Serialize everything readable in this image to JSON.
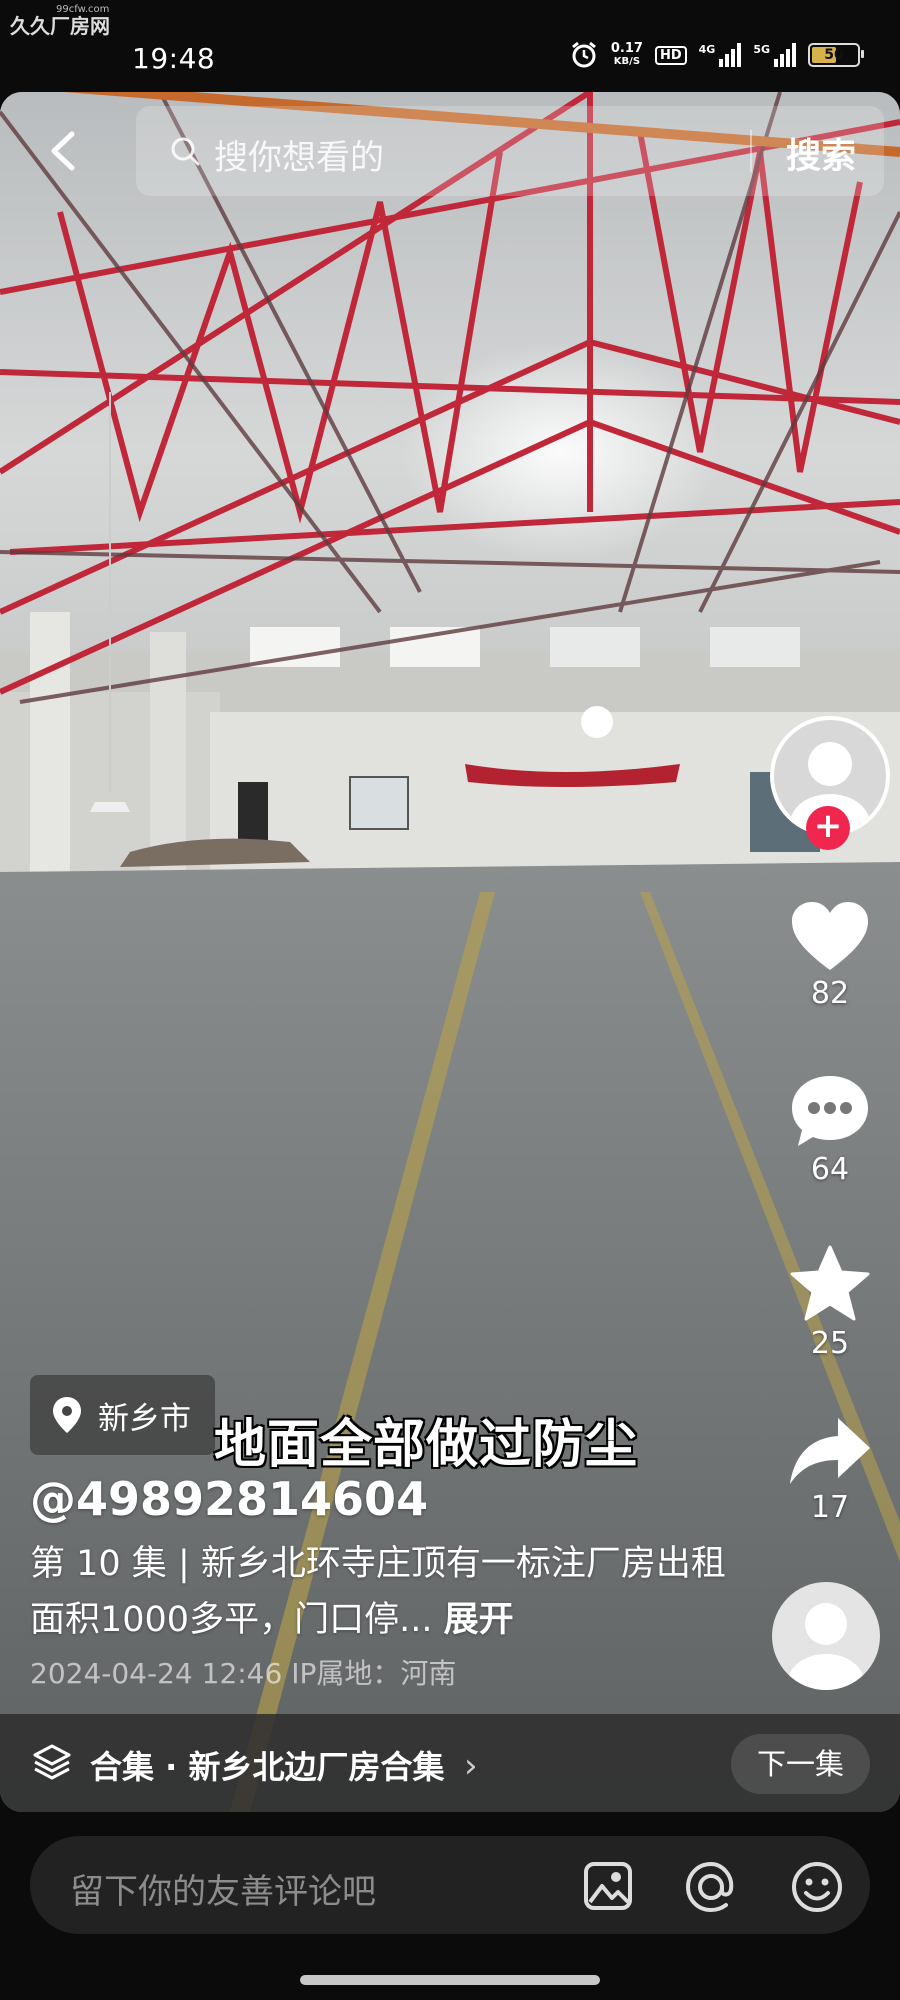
{
  "watermark": {
    "text": "久久厂房网",
    "small": "99cfw.com"
  },
  "status_bar": {
    "time": "19:48",
    "net_speed_value": "0.17",
    "net_speed_unit": "KB/S",
    "hd_label": "HD",
    "signal1_label": "4G",
    "signal2_label": "5G",
    "battery_level": "50"
  },
  "search": {
    "placeholder": "搜你想看的",
    "button": "搜索"
  },
  "actions": {
    "likes": "82",
    "comments": "64",
    "favorites": "25",
    "shares": "17",
    "follow_symbol": "+"
  },
  "post": {
    "location": "新乡市",
    "caption": "地面全部做过防尘",
    "handle": "@49892814604",
    "episode": "第 10 集",
    "description": "新乡北环寺庄顶有一标注厂房出租 面积1000多平，门口停...",
    "expand": "展开",
    "timestamp": "2024-04-24 12:46",
    "ip_location": "IP属地：河南"
  },
  "collection": {
    "label": "合集 · 新乡北边厂房合集",
    "chevron": "›",
    "next_button": "下一集"
  },
  "comment": {
    "placeholder": "留下你的友善评论吧"
  },
  "colors": {
    "like_red": "#f0264f",
    "truss_red": "#c0283a",
    "floor": "#6f7375"
  }
}
